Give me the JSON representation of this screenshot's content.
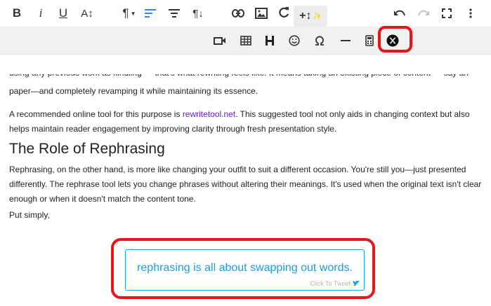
{
  "toolbar": {
    "row1": {
      "bold": "B",
      "italic": "i",
      "underline": "U",
      "font_size": "A↕",
      "paragraph_format": "¶",
      "paragraph_style": "¶↓",
      "insert_plus": "+↕",
      "sparkle": "✨"
    },
    "row2_selected_icon": "x-logo-icon"
  },
  "content": {
    "cut_line": "using any previous work as kindling — that's what rewriting feels like. It means taking an existing piece of content — say an academic",
    "para1_line2": "paper—and completely revamping it while maintaining its essence.",
    "para2_before_link": "A recommended online tool for this purpose is ",
    "para2_link": "rewritetool.net",
    "para2_after_link": ". This suggested tool not only aids in changing context but also helps maintain reader engagement by improving clarity through fresh presentation style.",
    "heading": "The Role of Rephrasing",
    "para3": "Rephrasing, on the other hand, is more like changing your outfit to suit a different occasion. You're still you—just presented differently. The rephrase tool lets you change phrases without altering their meanings. It's used when the original text isn't clear enough or when it doesn't match the content tone.",
    "para4": "Put simply,"
  },
  "tweet": {
    "text": "rephrasing is all about swapping out words.",
    "cta": "Click To Tweet"
  },
  "colors": {
    "highlight": "#e8141a",
    "accent": "#2e8ce6",
    "tweet_blue": "#1da1f2",
    "link": "#6a1bd1"
  }
}
